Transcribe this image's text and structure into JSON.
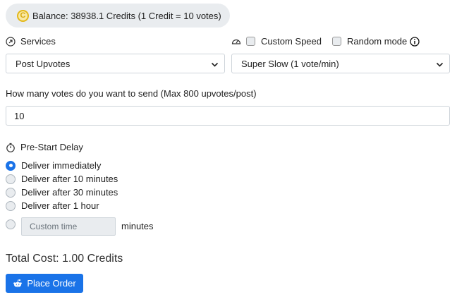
{
  "balance": {
    "text": "Balance: 38938.1 Credits (1 Credit = 10 votes)",
    "icon": "coin-icon"
  },
  "services": {
    "label": "Services",
    "selected": "Post Upvotes"
  },
  "speed": {
    "custom_speed_label": "Custom Speed",
    "random_mode_label": "Random mode",
    "selected": "Super Slow (1 vote/min)"
  },
  "votes": {
    "label": "How many votes do you want to send (Max 800 upvotes/post)",
    "value": "10"
  },
  "delay": {
    "label": "Pre-Start Delay",
    "options": [
      {
        "label": "Deliver immediately",
        "checked": true
      },
      {
        "label": "Deliver after 10 minutes",
        "checked": false
      },
      {
        "label": "Deliver after 30 minutes",
        "checked": false
      },
      {
        "label": "Deliver after 1 hour",
        "checked": false
      }
    ],
    "custom_placeholder": "Custom time",
    "custom_unit": "minutes"
  },
  "total": "Total Cost: 1.00 Credits",
  "place_order": "Place Order",
  "colors": {
    "accent": "#1a73e8",
    "coin": "#e3b81a"
  }
}
